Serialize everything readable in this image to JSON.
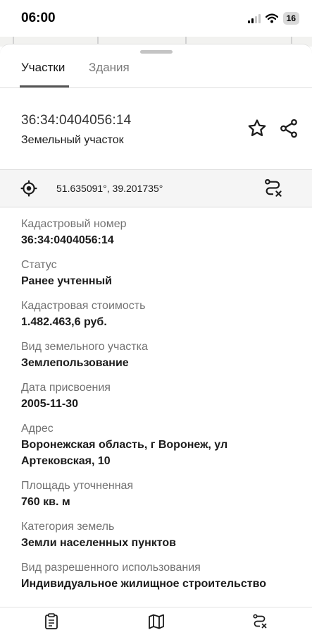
{
  "status_bar": {
    "time": "06:00",
    "battery": "16",
    "icons": [
      "signal-icon",
      "wifi-icon",
      "battery-icon"
    ]
  },
  "tabs": [
    {
      "label": "Участки",
      "active": true
    },
    {
      "label": "Здания",
      "active": false
    }
  ],
  "header": {
    "cadastral_number": "36:34:0404056:14",
    "object_type": "Земельный участок",
    "actions": [
      "star-icon",
      "share-icon"
    ]
  },
  "coordinates": {
    "text": "51.635091°, 39.201735°",
    "icons": [
      "locate-icon",
      "route-clear-icon"
    ]
  },
  "properties": [
    {
      "label": "Кадастровый номер",
      "value": "36:34:0404056:14"
    },
    {
      "label": "Статус",
      "value": "Ранее учтенный"
    },
    {
      "label": "Кадастровая стоимость",
      "value": "1.482.463,6 руб."
    },
    {
      "label": "Вид земельного участка",
      "value": "Землепользование"
    },
    {
      "label": "Дата присвоения",
      "value": "2005-11-30"
    },
    {
      "label": "Адрес",
      "value": "Воронежская область, г Воронеж, ул Артековская, 10"
    },
    {
      "label": "Площадь уточненная",
      "value": "760 кв. м"
    },
    {
      "label": "Категория земель",
      "value": "Земли населенных пунктов"
    },
    {
      "label": "Вид разрешенного использования",
      "value": "Индивидуальное жилищное строительство"
    }
  ],
  "bottom_nav": [
    "report-icon",
    "map-icon",
    "route-clear-icon"
  ],
  "colors": {
    "text": "#1b1b1b",
    "label": "#727272",
    "divider": "#dcdcdc",
    "coord_bg": "#f5f5f5"
  }
}
